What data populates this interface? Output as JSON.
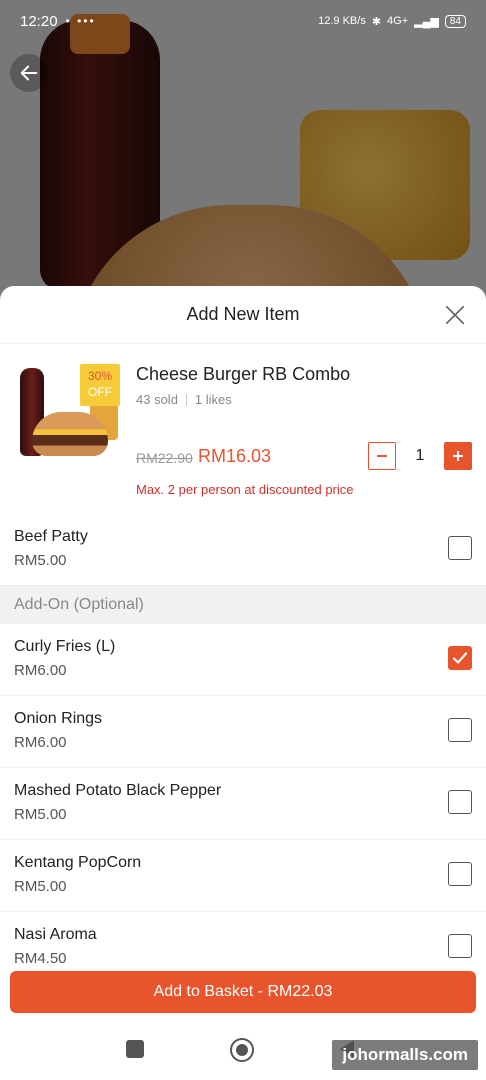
{
  "status_bar": {
    "time": "12:20",
    "left_icons": "• •••",
    "speed": "12.9 KB/s",
    "network": "4G+",
    "battery": "84"
  },
  "sheet": {
    "title": "Add New Item"
  },
  "product": {
    "name": "Cheese Burger RB Combo",
    "sold": "43 sold",
    "likes": "1 likes",
    "discount_pct": "30%",
    "discount_off": "OFF",
    "price_old": "RM22.90",
    "price_new": "RM16.03",
    "quantity": "1",
    "limit_note": "Max. 2 per person at discounted price"
  },
  "options": [
    {
      "name": "Beef Patty",
      "price": "RM5.00",
      "checked": false
    }
  ],
  "addon_section": {
    "title": "Add-On (Optional)",
    "items": [
      {
        "name": "Curly Fries (L)",
        "price": "RM6.00",
        "checked": true
      },
      {
        "name": "Onion Rings",
        "price": "RM6.00",
        "checked": false
      },
      {
        "name": "Mashed Potato Black Pepper",
        "price": "RM5.00",
        "checked": false
      },
      {
        "name": "Kentang PopCorn",
        "price": "RM5.00",
        "checked": false
      },
      {
        "name": "Nasi Aroma",
        "price": "RM4.50",
        "checked": false
      }
    ]
  },
  "cta": {
    "label": "Add to Basket - RM22.03"
  },
  "watermark": "johormalls.com",
  "colors": {
    "accent": "#e8542b",
    "limit_text": "#d0312d",
    "badge": "#f6cb3a"
  }
}
